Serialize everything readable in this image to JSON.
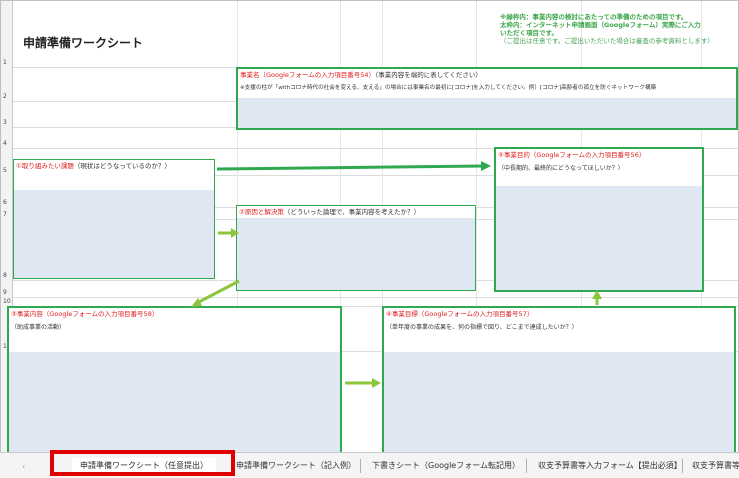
{
  "sheet": {
    "title": "申請準備ワークシート",
    "row_numbers": [
      "1",
      "2",
      "3",
      "4",
      "5",
      "6",
      "7",
      "8",
      "9",
      "10",
      "11"
    ],
    "note": {
      "line1": "※緑枠内：事業内容の検討にあたっての準備のための項目です。",
      "line2": "太枠内：インターネット申請画面（Googleフォーム）実際にご入力",
      "line3": "いただく項目です。",
      "line4": "（ご提出は任意です。ご提出いただいた場合は審査の参考資料とします）"
    },
    "project_name": {
      "label": "事業名（Googleフォームの入力項目番号54）",
      "label_suffix": "（事業内容を端的に表してください）",
      "example": "※支援の柱が「withコロナ時代の社会を変える、支える」の場合には事業名の最初に[コロナ]を入力してください。例）[コロナ]高齢者の孤立を防ぐネットワーク構築"
    },
    "issue": {
      "label": "①取り組みたい課題",
      "label_suffix": "（現状はどうなっているのか？）"
    },
    "cause": {
      "label": "②原因と解決策",
      "label_suffix": "（どういった論理で、事業内容を考えたか？）"
    },
    "purpose": {
      "label": "⑤事業目的（Googleフォームの入力項目番号56）",
      "sub": "（中長期的、最終的にどうなってほしいか？）"
    },
    "content": {
      "label": "③事業内容（Googleフォームの入力項目番号58）",
      "sub": "（助成事業の活動）"
    },
    "goal": {
      "label": "④事業目標（Googleフォームの入力項目番号57）",
      "sub": "（単年度の事業の成果を、何の指標で図り、どこまで達成したいか？）"
    }
  },
  "tabs": [
    {
      "label": "申請準備ワークシート（任意提出）",
      "active": true
    },
    {
      "label": "申請準備ワークシート（記入例）",
      "active": false
    },
    {
      "label": "下書きシート（Googleフォーム転記用）",
      "active": false
    },
    {
      "label": "収支予算書等入力フォーム【提出必須】",
      "active": false
    },
    {
      "label": "収支予算書等",
      "active": false
    }
  ],
  "nav_arrow": "‹",
  "colors": {
    "accent_green": "#2fa84f",
    "input_fill": "#dfe8f2",
    "highlight_red": "#e00000",
    "label_red": "#e02020"
  }
}
